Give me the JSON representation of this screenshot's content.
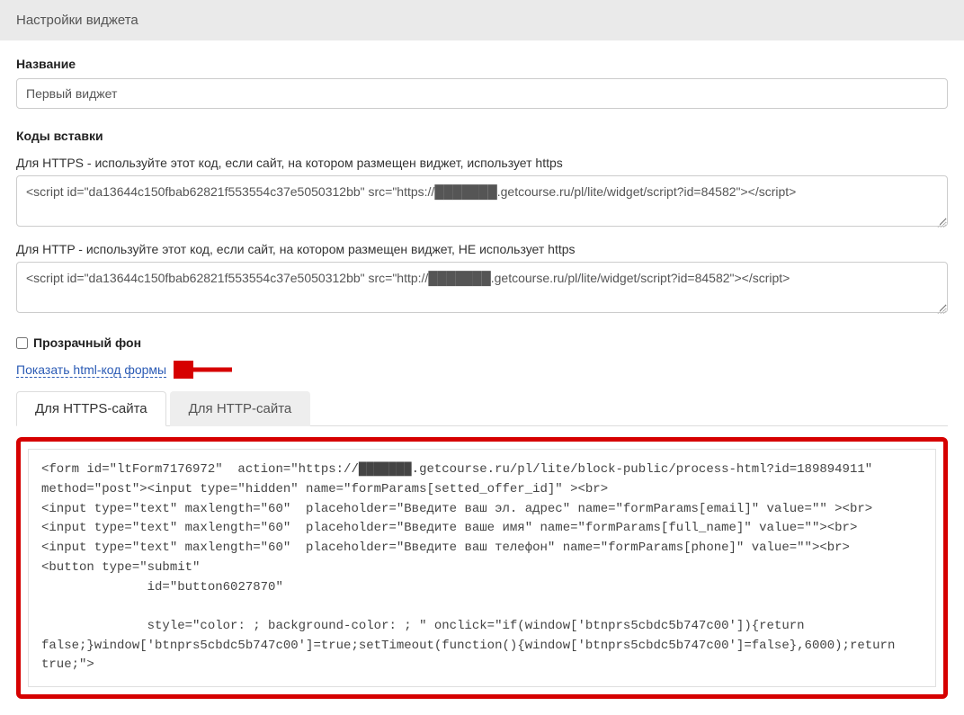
{
  "header": {
    "title": "Настройки виджета"
  },
  "name_section": {
    "label": "Название",
    "value": "Первый виджет"
  },
  "embed_section": {
    "heading": "Коды вставки",
    "https_label": "Для HTTPS - используйте этот код, если сайт, на котором размещен виджет, использует https",
    "https_code": "<script id=\"da13644c150fbab62821f553554c37e5050312bb\" src=\"https://███████.getcourse.ru/pl/lite/widget/script?id=84582\"></script>",
    "http_label": "Для HTTP - используйте этот код, если сайт, на котором размещен виджет, НЕ использует https",
    "http_code": "<script id=\"da13644c150fbab62821f553554c37e5050312bb\" src=\"http://███████.getcourse.ru/pl/lite/widget/script?id=84582\"></script>"
  },
  "transparent_bg": {
    "label": "Прозрачный фон"
  },
  "show_html_link": "Показать html-код формы",
  "tabs": {
    "https": "Для HTTPS-сайта",
    "http": "Для HTTP-сайта"
  },
  "form_code": "<form id=\"ltForm7176972\"  action=\"https://███████.getcourse.ru/pl/lite/block-public/process-html?id=189894911\" method=\"post\"><input type=\"hidden\" name=\"formParams[setted_offer_id]\" ><br>\n<input type=\"text\" maxlength=\"60\"  placeholder=\"Введите ваш эл. адрес\" name=\"formParams[email]\" value=\"\" ><br>\n<input type=\"text\" maxlength=\"60\"  placeholder=\"Введите ваше имя\" name=\"formParams[full_name]\" value=\"\"><br>\n<input type=\"text\" maxlength=\"60\"  placeholder=\"Введите ваш телефон\" name=\"formParams[phone]\" value=\"\"><br>\n<button type=\"submit\"\n              id=\"button6027870\"\n             \n              style=\"color: ; background-color: ; \" onclick=\"if(window['btnprs5cbdc5b747c00']){return false;}window['btnprs5cbdc5b747c00']=true;setTimeout(function(){window['btnprs5cbdc5b747c00']=false},6000);return true;\">"
}
